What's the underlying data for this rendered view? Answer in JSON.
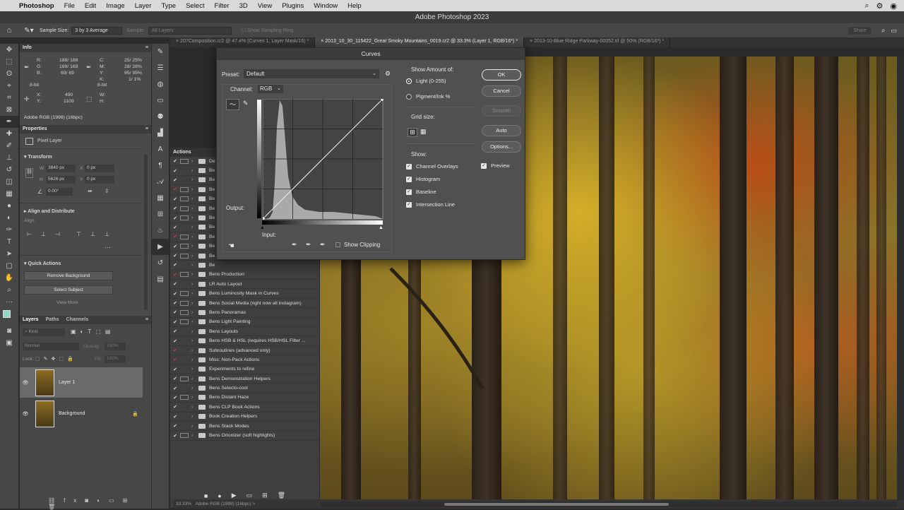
{
  "menubar": {
    "apple": "",
    "app": "Photoshop",
    "items": [
      "File",
      "Edit",
      "Image",
      "Layer",
      "Type",
      "Select",
      "Filter",
      "3D",
      "View",
      "Plugins",
      "Window",
      "Help"
    ],
    "right_icons": [
      "search-icon",
      "control-center-icon",
      "siri-icon"
    ]
  },
  "title": "Adobe Photoshop 2023",
  "options": {
    "sample_size_label": "Sample Size:",
    "sample_size_value": "3 by 3 Average",
    "sample_label": "Sample:",
    "sample_value": "All Layers",
    "show_ring": "Show Sampling Ring",
    "share": "Share"
  },
  "tabs": [
    {
      "label": "207Composition.cr2 @ 47.4% (Curves 1, Layer Mask/16) *",
      "active": false
    },
    {
      "label": "2013_10_30_115422_Great Smoky Mountains_0019.cr2 @ 33.3% (Layer 1, RGB/16*) *",
      "active": true
    },
    {
      "label": "2013-10-Blue Ridge Parkway-00052.tif @ 50% (RGB/16*) *",
      "active": false
    }
  ],
  "info": {
    "tab": "Info",
    "r": "188/ 188",
    "g": "169/ 169",
    "b": "69/ 69",
    "c": "25/ 25%",
    "m": "28/ 28%",
    "y": "95/ 95%",
    "k": "1/ 1%",
    "bit1": "8-bit",
    "bit2": "8-bit",
    "x": "490",
    "y_coord": "1109",
    "w": "",
    "h": "",
    "profile": "Adobe RGB (1998) (16bpc)",
    "labels": {
      "r": "R:",
      "g": "G:",
      "b": "B:",
      "c": "C:",
      "m": "M:",
      "y": "Y:",
      "k": "K:",
      "x": "X:",
      "yc": "Y:",
      "w": "W:",
      "h": "H:"
    }
  },
  "properties": {
    "tab": "Properties",
    "layer_type": "Pixel Layer",
    "transform": "Transform",
    "w": "3840 px",
    "h": "5626 px",
    "x": "0 px",
    "y": "0 px",
    "angle": "0.00°",
    "align": "Align and Distribute",
    "align_label": "Align:",
    "quick": "Quick Actions",
    "remove_bg": "Remove Background",
    "select_subject": "Select Subject",
    "view_more": "View More",
    "labels": {
      "w": "W",
      "h": "H",
      "x": "X",
      "y": "Y"
    }
  },
  "layers": {
    "tabs": [
      "Layers",
      "Paths",
      "Channels"
    ],
    "kind": "Kind",
    "blend": "Normal",
    "opacity_label": "Opacity:",
    "opacity": "100%",
    "lock_label": "Lock:",
    "fill_label": "Fill:",
    "fill": "100%",
    "items": [
      {
        "name": "Layer 1"
      },
      {
        "name": "Background"
      }
    ]
  },
  "actions": {
    "tab": "Actions",
    "items": [
      {
        "name": "De",
        "red": false,
        "dlg": true
      },
      {
        "name": "Be",
        "red": false,
        "dlg": false
      },
      {
        "name": "Be",
        "red": false,
        "dlg": false
      },
      {
        "name": "Be",
        "red": true,
        "dlg": true
      },
      {
        "name": "Be",
        "red": false,
        "dlg": true
      },
      {
        "name": "Be",
        "red": false,
        "dlg": true
      },
      {
        "name": "Be",
        "red": false,
        "dlg": true
      },
      {
        "name": "Be",
        "red": false,
        "dlg": false
      },
      {
        "name": "Be",
        "red": true,
        "dlg": true
      },
      {
        "name": "Be",
        "red": false,
        "dlg": true
      },
      {
        "name": "Be",
        "red": false,
        "dlg": true
      },
      {
        "name": "Be",
        "red": false,
        "dlg": false
      },
      {
        "name": "Bens Production",
        "red": true,
        "dlg": true
      },
      {
        "name": "LR Auto Layout",
        "red": false,
        "dlg": false
      },
      {
        "name": "Bens Luminosity Mask in Curves",
        "red": false,
        "dlg": true
      },
      {
        "name": "Bens Social Media (right now all instagram)",
        "red": false,
        "dlg": true
      },
      {
        "name": "Bens Panoramas",
        "red": false,
        "dlg": true
      },
      {
        "name": "Bens Light Painting",
        "red": false,
        "dlg": true
      },
      {
        "name": "Bens Layouts",
        "red": false,
        "dlg": false
      },
      {
        "name": "Bens HSB & HSL (requires HSB/HSL Filter ...",
        "red": false,
        "dlg": false
      },
      {
        "name": "Subroutines (advanced only)",
        "red": true,
        "dlg": false
      },
      {
        "name": "Misc: Non-Pack Actions",
        "red": true,
        "dlg": false
      },
      {
        "name": "Experiments to refine",
        "red": false,
        "dlg": false
      },
      {
        "name": "Bens Demonstration Helpers",
        "red": false,
        "dlg": true
      },
      {
        "name": "Bens Selecto-cool",
        "red": false,
        "dlg": false
      },
      {
        "name": "Bens Distant Haze",
        "red": false,
        "dlg": true
      },
      {
        "name": "Bens CLP Book Actions",
        "red": false,
        "dlg": false
      },
      {
        "name": "Book Creation Helpers",
        "red": false,
        "dlg": false
      },
      {
        "name": "Bens Stack Modes",
        "red": false,
        "dlg": false
      },
      {
        "name": "Bens Ortonizer (soft highlights)",
        "red": false,
        "dlg": true
      }
    ]
  },
  "curves": {
    "title": "Curves",
    "preset_label": "Preset:",
    "preset": "Default",
    "channel_label": "Channel:",
    "channel": "RGB",
    "output": "Output:",
    "input": "Input:",
    "show_clipping": "Show Clipping",
    "show_amount": "Show Amount of:",
    "light": "Light  (0-255)",
    "pigment": "Pigment/Ink %",
    "grid_size": "Grid size:",
    "show": "Show:",
    "channel_overlays": "Channel Overlays",
    "histogram": "Histogram",
    "baseline": "Baseline",
    "intersection": "Intersection Line",
    "ok": "OK",
    "cancel": "Cancel",
    "smooth": "Smooth",
    "auto": "Auto",
    "options": "Options...",
    "preview": "Preview"
  },
  "status": {
    "zoom": "33.33%",
    "profile": "Adobe RGB (1998) (16bpc)"
  }
}
